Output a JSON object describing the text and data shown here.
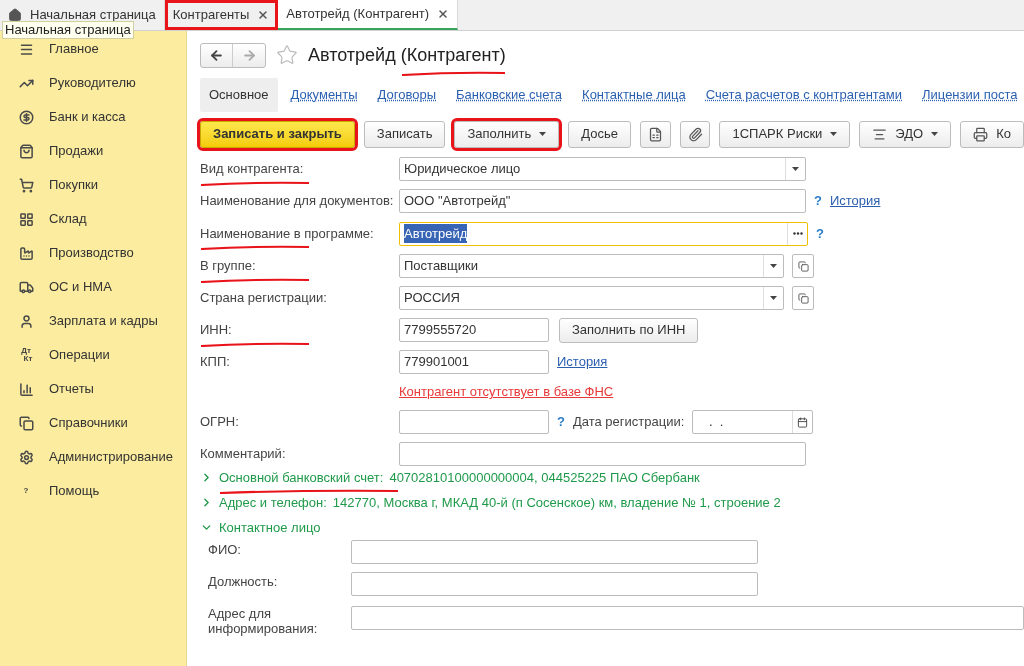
{
  "tabs": [
    {
      "label": "Начальная страница",
      "kind": "home",
      "selected": false,
      "boxed": false
    },
    {
      "label": "Контрагенты",
      "kind": "closable",
      "selected": false,
      "boxed": true
    },
    {
      "label": "Автотрейд (Контрагент)",
      "kind": "closable",
      "selected": true,
      "boxed": false
    }
  ],
  "tooltip": "Начальная страница",
  "sidebar": {
    "items": [
      {
        "label": "Главное",
        "kind": "menu"
      },
      {
        "label": "Руководителю",
        "kind": "trend"
      },
      {
        "label": "Банк и касса",
        "kind": "coin"
      },
      {
        "label": "Продажи",
        "kind": "bag"
      },
      {
        "label": "Покупки",
        "kind": "cart"
      },
      {
        "label": "Склад",
        "kind": "grid"
      },
      {
        "label": "Производство",
        "kind": "factory"
      },
      {
        "label": "ОС и НМА",
        "kind": "truck"
      },
      {
        "label": "Зарплата и кадры",
        "kind": "person"
      },
      {
        "label": "Операции",
        "kind": "glyphs",
        "icon_text": [
          "Дт",
          "Кт"
        ]
      },
      {
        "label": "Отчеты",
        "kind": "bars"
      },
      {
        "label": "Справочники",
        "kind": "books"
      },
      {
        "label": "Администрирование",
        "kind": "gear"
      },
      {
        "label": "Помощь",
        "kind": "glyphs",
        "icon_text": [
          "?"
        ]
      }
    ]
  },
  "form": {
    "title": "Автотрейд (Контрагент)",
    "title_underlined": true,
    "sub_tabs": [
      {
        "label": "Основное",
        "selected": true
      },
      {
        "label": "Документы",
        "selected": false
      },
      {
        "label": "Договоры",
        "selected": false
      },
      {
        "label": "Банковские счета",
        "selected": false
      },
      {
        "label": "Контактные лица",
        "selected": false
      },
      {
        "label": "Счета расчетов с контрагентами",
        "selected": false
      },
      {
        "label": "Лицензии поста",
        "selected": false
      }
    ],
    "toolbar": [
      {
        "kind": "primary",
        "label": "Записать и закрыть",
        "boxed": true
      },
      {
        "kind": "plain",
        "label": "Записать",
        "boxed": false
      },
      {
        "kind": "dropdown",
        "label": "Заполнить",
        "boxed": true
      },
      {
        "kind": "plain",
        "label": "Досье",
        "boxed": false
      },
      {
        "kind": "icon",
        "boxed": false
      },
      {
        "kind": "icon",
        "boxed": false
      },
      {
        "kind": "dropdown",
        "label": "1СПАРК Риски",
        "boxed": false
      },
      {
        "kind": "dropdown",
        "label": "ЭДО",
        "boxed": false
      },
      {
        "kind": "plain",
        "label": "Ко",
        "boxed": false
      }
    ],
    "fields": [
      {
        "kind": "select",
        "label": "Вид контрагента:",
        "underlined": true,
        "value": "Юридическое лицо"
      },
      {
        "kind": "text",
        "label": "Наименование для документов:",
        "underlined": false,
        "value": "ООО \"Автотрейд\"",
        "help": "?",
        "link": "История"
      },
      {
        "kind": "choice",
        "label": "Наименование в программе:",
        "underlined": true,
        "value": "Автотрейд",
        "focused": true,
        "help": "?"
      },
      {
        "kind": "select_open",
        "label": "В группе:",
        "underlined": true,
        "value": "Поставщики"
      },
      {
        "kind": "select_open",
        "label": "Страна регистрации:",
        "underlined": false,
        "value": "РОССИЯ"
      },
      {
        "kind": "short",
        "label": "ИНН:",
        "underlined": true,
        "value": "7799555720",
        "button": "Заполнить по ИНН"
      },
      {
        "kind": "short",
        "label": "КПП:",
        "underlined": false,
        "value": "779901001",
        "link": "История"
      },
      {
        "kind": "warning",
        "text": "Контрагент отсутствует в базе ФНС"
      },
      {
        "kind": "date_row",
        "label": "ОГРН:",
        "underlined": false,
        "help": "?",
        "label2": "Дата регистрации:",
        "date": " .  ."
      },
      {
        "kind": "text",
        "label": "Комментарий:",
        "underlined": false
      }
    ],
    "groups": [
      {
        "title": "Основной банковский счет:",
        "value": "40702810100000000004, 044525225 ПАО Сбербанк",
        "expanded": false,
        "underlined": true
      },
      {
        "title": "Адрес и телефон:",
        "value": "142770, Москва г, МКАД 40-й (п Сосенское) км, владение № 1, строение 2",
        "expanded": false,
        "underlined": false
      },
      {
        "title": "Контактное лицо",
        "expanded": true,
        "underlined": false,
        "fields": [
          {
            "label": "ФИО:",
            "kind": "text"
          },
          {
            "label": "Должность:",
            "kind": "text"
          },
          {
            "label": "Адрес для информирования:",
            "kind": "wide"
          }
        ]
      }
    ]
  }
}
